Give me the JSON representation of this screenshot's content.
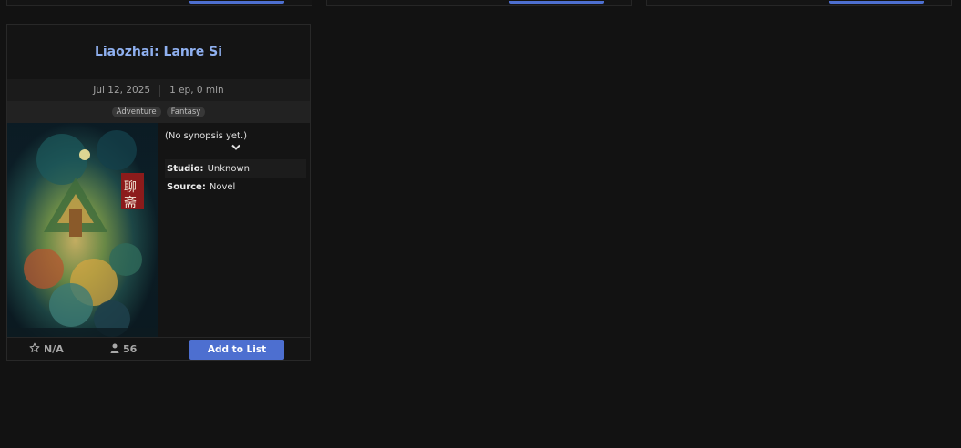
{
  "colors": {
    "page_bg": "#121212",
    "card_bg": "#141414",
    "title": "#8fb0f0",
    "accent_button": "#4d6fd0"
  },
  "card": {
    "title": "Liaozhai: Lanre Si",
    "date": "Jul 12, 2025",
    "episodes": "1 ep, 0 min",
    "genres": [
      "Adventure",
      "Fantasy"
    ],
    "synopsis": "(No synopsis yet.)",
    "expand_icon": "chevron-down-icon",
    "studio_label": "Studio:",
    "studio_value": "Unknown",
    "source_label": "Source:",
    "source_value": "Novel",
    "score": "N/A",
    "score_icon": "star-outline-icon",
    "members": "56",
    "members_icon": "user-icon",
    "add_button": "Add to List"
  }
}
